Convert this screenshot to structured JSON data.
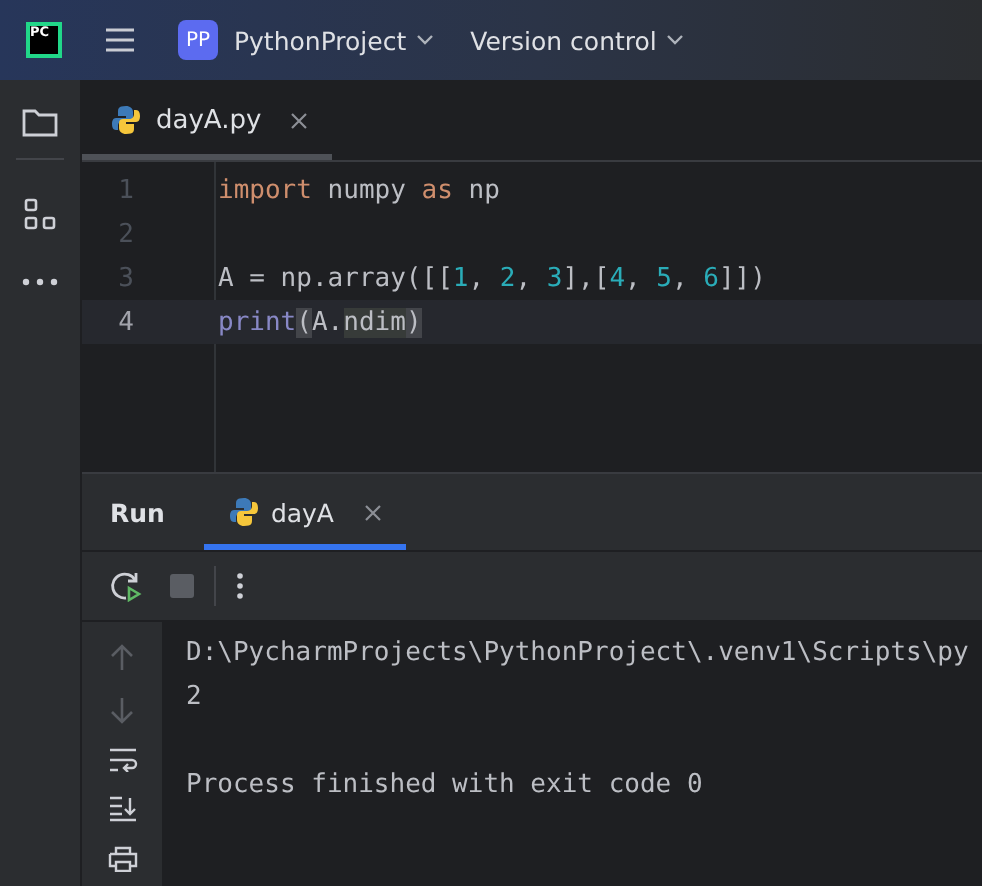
{
  "title_bar": {
    "app_badge": "PC",
    "project_badge": "PP",
    "project": "PythonProject",
    "vcs": "Version control"
  },
  "editor": {
    "tabs": [
      {
        "label": "dayA.py",
        "selected": true
      }
    ],
    "lines": [
      {
        "number": "1",
        "current": false,
        "tokens": [
          {
            "text": "import",
            "kind": "keyword"
          },
          {
            "text": " numpy ",
            "kind": "plain"
          },
          {
            "text": "as",
            "kind": "keyword"
          },
          {
            "text": " np",
            "kind": "plain"
          }
        ]
      },
      {
        "number": "2",
        "current": false
      },
      {
        "number": "3",
        "current": false,
        "tokens": [
          {
            "text": "A = np.array([[",
            "kind": "plain"
          },
          {
            "text": "1",
            "kind": "number"
          },
          {
            "text": ", ",
            "kind": "plain"
          },
          {
            "text": "2",
            "kind": "number"
          },
          {
            "text": ", ",
            "kind": "plain"
          },
          {
            "text": "3",
            "kind": "number"
          },
          {
            "text": "],[",
            "kind": "plain"
          },
          {
            "text": "4",
            "kind": "number"
          },
          {
            "text": ", ",
            "kind": "plain"
          },
          {
            "text": "5",
            "kind": "number"
          },
          {
            "text": ", ",
            "kind": "plain"
          },
          {
            "text": "6",
            "kind": "number"
          },
          {
            "text": "]])",
            "kind": "plain"
          }
        ]
      },
      {
        "number": "4",
        "current": true,
        "tokens": [
          {
            "text": "print",
            "kind": "builtin"
          },
          {
            "text": "(",
            "kind": "brace"
          },
          {
            "text": "A.",
            "kind": "plain"
          },
          {
            "text": "ndim",
            "kind": "match"
          },
          {
            "text": ")",
            "kind": "brace"
          }
        ]
      }
    ]
  },
  "run_panel": {
    "title": "Run",
    "tabs": [
      {
        "label": "dayA",
        "selected": true
      }
    ],
    "output_blocks": [
      [
        "D:\\PycharmProjects\\PythonProject\\.venv1\\Scripts\\py",
        "2"
      ],
      [
        "Process finished with exit code 0"
      ]
    ]
  }
}
